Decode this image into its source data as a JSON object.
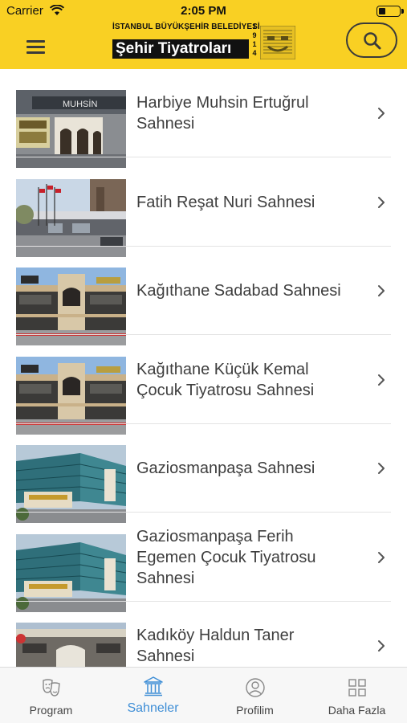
{
  "status_bar": {
    "carrier": "Carrier",
    "time": "2:05 PM",
    "battery_level": 0.35
  },
  "header": {
    "logo_top": "İSTANBUL BÜYÜKŞEHİR BELEDİYESİ",
    "logo_main": "Şehir Tiyatroları",
    "logo_year": [
      "1",
      "9",
      "1",
      "4"
    ]
  },
  "stages": [
    {
      "lines": [
        "Harbiye Muhsin Ertuğrul",
        "Sahnesi"
      ],
      "photo": "harbiye"
    },
    {
      "lines": [
        "Fatih Reşat Nuri Sahnesi"
      ],
      "photo": "fatih"
    },
    {
      "lines": [
        "Kağıthane Sadabad Sahnesi"
      ],
      "photo": "kagithane"
    },
    {
      "lines": [
        "Kağıthane Küçük Kemal",
        "Çocuk Tiyatrosu Sahnesi"
      ],
      "photo": "kagithane"
    },
    {
      "lines": [
        "Gaziosmanpaşa Sahnesi"
      ],
      "photo": "gaziosmanpasa"
    },
    {
      "lines": [
        "Gaziosmanpaşa Ferih",
        "Egemen Çocuk Tiyatrosu",
        "Sahnesi"
      ],
      "photo": "gaziosmanpasa"
    },
    {
      "lines": [
        "Kadıköy Haldun Taner",
        "Sahnesi"
      ],
      "photo": "kadikoy"
    }
  ],
  "tabs": [
    {
      "label": "Program",
      "icon": "theater-masks-icon"
    },
    {
      "label": "Sahneler",
      "icon": "building-columns-icon",
      "active": true
    },
    {
      "label": "Profilim",
      "icon": "user-icon"
    },
    {
      "label": "Daha Fazla",
      "icon": "grid-icon"
    }
  ],
  "colors": {
    "brand_yellow": "#f9d023",
    "active_tab": "#3e8ed6",
    "text": "#3e3e3e"
  }
}
